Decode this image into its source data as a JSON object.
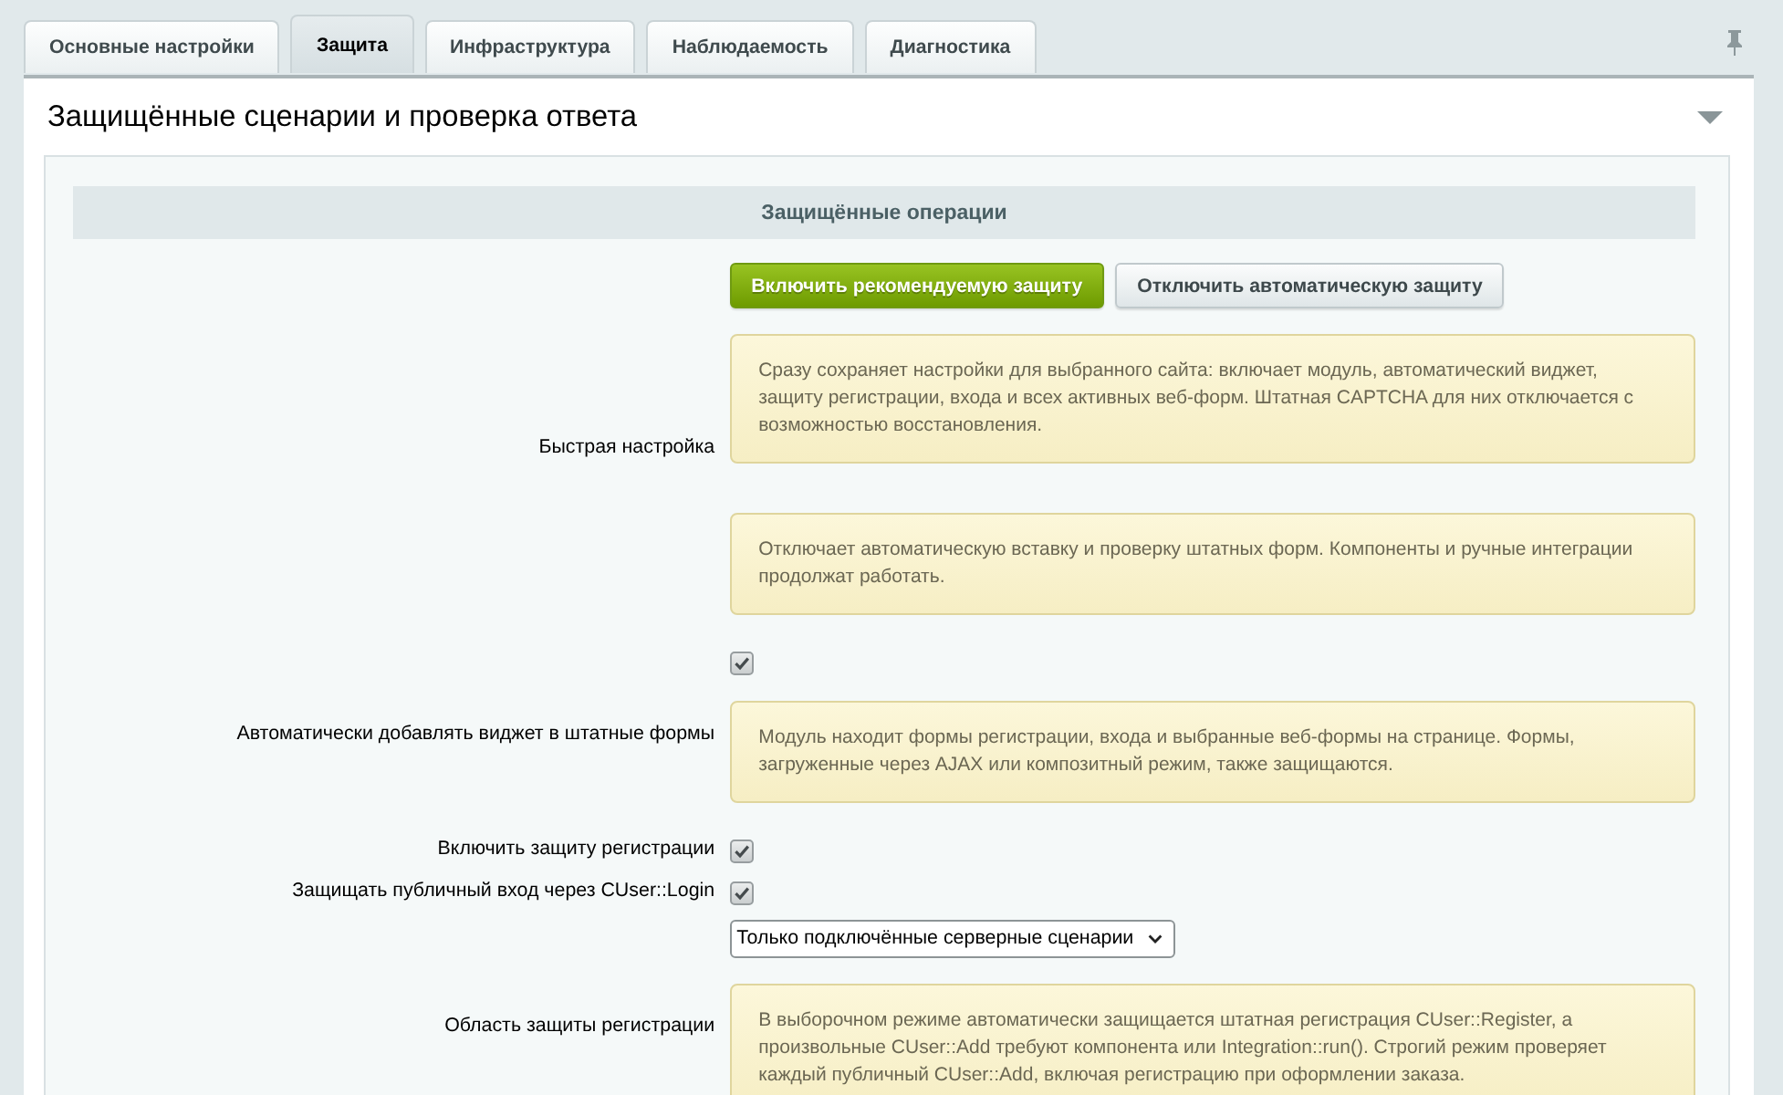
{
  "tabs": [
    {
      "label": "Основные настройки",
      "selected": false
    },
    {
      "label": "Защита",
      "selected": true
    },
    {
      "label": "Инфраструктура",
      "selected": false
    },
    {
      "label": "Наблюдаемость",
      "selected": false
    },
    {
      "label": "Диагностика",
      "selected": false
    }
  ],
  "panel": {
    "title": "Защищённые сценарии и проверка ответа"
  },
  "section": {
    "title": "Защищённые операции"
  },
  "rows": [
    {
      "label": "Быстрая настройка",
      "controls": [
        {
          "kind": "buttons",
          "buttons": [
            {
              "kind": "primary",
              "label": "Включить рекомендуемую защиту"
            },
            {
              "kind": "default",
              "label": "Отключить автоматическую защиту"
            }
          ]
        },
        {
          "kind": "note",
          "text": "Сразу сохраняет настройки для выбранного сайта: включает модуль, автоматический виджет, защиту регистрации, входа и всех активных веб-форм. Штатная CAPTCHA для них отключается с возможностью восстановления."
        },
        {
          "kind": "note",
          "text": "Отключает автоматическую вставку и проверку штатных форм. Компоненты и ручные интеграции продолжат работать."
        }
      ]
    },
    {
      "label": "Автоматически добавлять виджет в штатные формы",
      "controls": [
        {
          "kind": "checkbox",
          "checked": true
        },
        {
          "kind": "note",
          "text": "Модуль находит формы регистрации, входа и выбранные веб-формы на странице. Формы, загруженные через AJAX или композитный режим, также защищаются."
        }
      ]
    },
    {
      "label": "Включить защиту регистрации",
      "controls": [
        {
          "kind": "checkbox",
          "checked": true
        }
      ]
    },
    {
      "label": "Защищать публичный вход через CUser::Login",
      "controls": [
        {
          "kind": "checkbox",
          "checked": true
        }
      ]
    },
    {
      "label": "Область защиты регистрации",
      "controls": [
        {
          "kind": "select",
          "value": "Только подключённые серверные сценарии"
        },
        {
          "kind": "note",
          "text": "В выборочном режиме автоматически защищается штатная регистрация CUser::Register, а произвольные CUser::Add требуют компонента или Integration::run(). Строгий режим проверяет каждый публичный CUser::Add, включая регистрацию при оформлении заказа."
        }
      ]
    }
  ]
}
